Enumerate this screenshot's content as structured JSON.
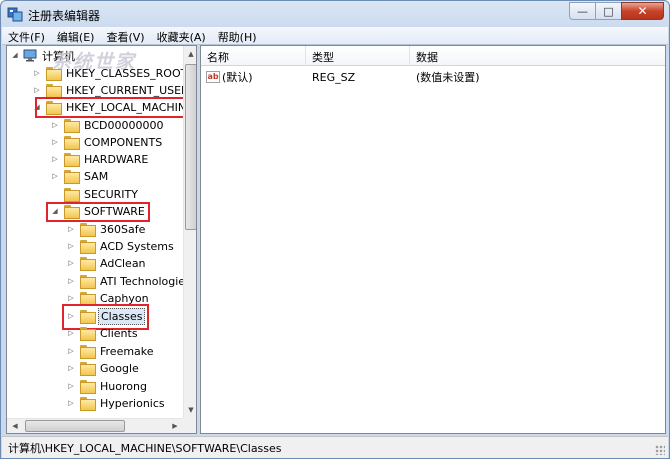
{
  "window": {
    "title": "注册表编辑器",
    "minimize_glyph": "—",
    "maximize_glyph": "□",
    "close_glyph": "✕"
  },
  "menu": [
    "文件(F)",
    "编辑(E)",
    "查看(V)",
    "收藏夹(A)",
    "帮助(H)"
  ],
  "tree": {
    "root": "计算机",
    "watermark": "系统世家",
    "hives": [
      "HKEY_CLASSES_ROOT",
      "HKEY_CURRENT_USER",
      "HKEY_LOCAL_MACHINE"
    ],
    "hklm_children": [
      "BCD00000000",
      "COMPONENTS",
      "HARDWARE",
      "SAM",
      "SECURITY",
      "SOFTWARE"
    ],
    "software_children": [
      "360Safe",
      "ACD Systems",
      "AdClean",
      "ATI Technologie",
      "Caphyon",
      "Classes",
      "Clients",
      "Freemake",
      "Google",
      "Huorong",
      "Hyperionics"
    ],
    "selected": "Classes"
  },
  "list": {
    "columns": [
      "名称",
      "类型",
      "数据"
    ],
    "rows": [
      {
        "icon": "ab",
        "name": "(默认)",
        "type": "REG_SZ",
        "data": "(数值未设置)"
      }
    ]
  },
  "status": {
    "path": "计算机\\HKEY_LOCAL_MACHINE\\SOFTWARE\\Classes"
  },
  "colors": {
    "highlight_box": "#e0242d",
    "folder": "#f2c64d",
    "title_gradient": "#c9d9ee"
  }
}
